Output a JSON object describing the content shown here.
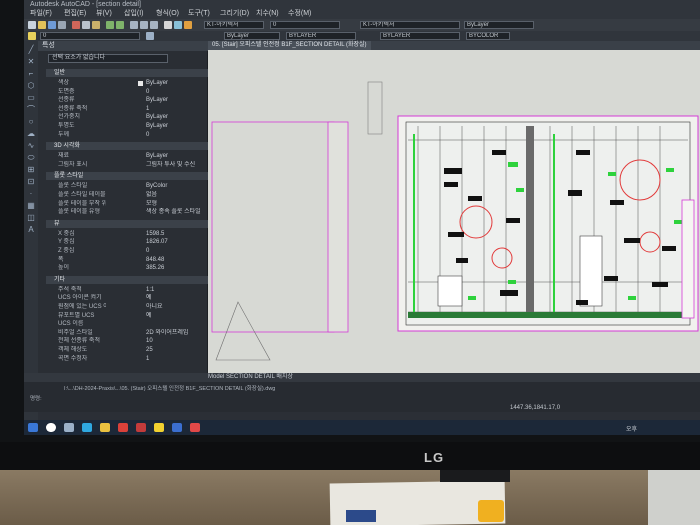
{
  "window": {
    "title": "Autodesk AutoCAD - [section detail]"
  },
  "menu": [
    "파일(F)",
    "편집(E)",
    "뷰(V)",
    "삽입(I)",
    "형식(O)",
    "도구(T)",
    "그리기(D)",
    "치수(N)",
    "수정(M)"
  ],
  "toolbar": {
    "layer_value": "0",
    "color_value": "ByLayer",
    "linetype_value": "BYLAYER",
    "lineweight_value": "BYLAYER",
    "bycolor_value": "BYCOLOR",
    "textstyle_value": "KT-아키텍처"
  },
  "properties": {
    "title": "특성",
    "selection": "선택 요소가 없습니다",
    "sections": {
      "general": "일반",
      "view3d": "3D 시각화",
      "plot": "플롯 스타일",
      "view": "뷰",
      "misc": "기타"
    },
    "general_rows": [
      {
        "key": "색상",
        "value": "ByLayer",
        "swatch": true
      },
      {
        "key": "도면층",
        "value": "0"
      },
      {
        "key": "선종류",
        "value": "ByLayer"
      },
      {
        "key": "선종류 축척",
        "value": "1"
      },
      {
        "key": "선가중치",
        "value": "ByLayer"
      },
      {
        "key": "투명도",
        "value": "ByLayer"
      },
      {
        "key": "두께",
        "value": "0"
      }
    ],
    "view3d_rows": [
      {
        "key": "재료",
        "value": "ByLayer"
      },
      {
        "key": "그림자 표시",
        "value": "그림자 투사 및 수신"
      }
    ],
    "plot_rows": [
      {
        "key": "플롯 스타일",
        "value": "ByColor"
      },
      {
        "key": "플롯 스타일 테이블",
        "value": "없음"
      },
      {
        "key": "플롯 테이블 부착 위치",
        "value": "모형"
      },
      {
        "key": "플롯 테이블 유형",
        "value": "색상 종속 플롯 스타일"
      }
    ],
    "view_rows": [
      {
        "key": "X 중심",
        "value": "1598.5"
      },
      {
        "key": "Y 중심",
        "value": "1826.07"
      },
      {
        "key": "Z 중심",
        "value": "0"
      },
      {
        "key": "폭",
        "value": "848.48"
      },
      {
        "key": "높이",
        "value": "385.26"
      }
    ],
    "misc_rows": [
      {
        "key": "주석 축척",
        "value": "1:1"
      },
      {
        "key": "UCS 아이콘 켜기",
        "value": "예"
      },
      {
        "key": "원점에 있는 UCS 아이콘",
        "value": "아니요"
      },
      {
        "key": "뷰포트별 UCS",
        "value": "예"
      },
      {
        "key": "UCS 이름",
        "value": ""
      },
      {
        "key": "비주얼 스타일",
        "value": "2D 와이어프레임"
      },
      {
        "key": "전체 선종류 축척",
        "value": "10"
      },
      {
        "key": "객체 해상도",
        "value": "25"
      },
      {
        "key": "곡면 수정자",
        "value": "1"
      }
    ]
  },
  "drawing": {
    "tab_label": "05. [Stair] 오피스텔 인전정 B1F_SECTION DETAIL (화장실)"
  },
  "layout_tabs": "Model  SECTION DETAIL 배치상",
  "command": {
    "history_line": "I:\\...\\DH-2024-Praxis\\...\\05. (Stair) 오피스텔 인전정 B1F_SECTION DETAIL (화장실).dwg",
    "prompt_label": "명령:"
  },
  "coords": "1447.36,1841.17,0",
  "tray_time": "오후",
  "monitor_brand": "LG",
  "colors": {
    "panel_bg": "#2a2e34",
    "drawing_bg": "#d7d9d4",
    "magenta": "#d43ad6",
    "green": "#2ed23c",
    "red": "#e23a3a",
    "taskbar": "#1c2838"
  }
}
